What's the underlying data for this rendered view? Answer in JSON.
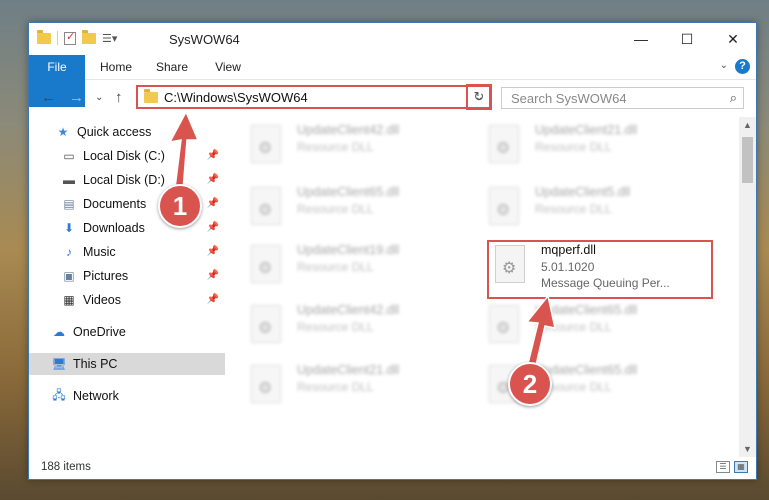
{
  "window": {
    "title": "SysWOW64",
    "controls": {
      "minimize": "—",
      "maximize": "☐",
      "close": "✕"
    }
  },
  "ribbon": {
    "tabs": [
      "File",
      "Home",
      "Share",
      "View"
    ],
    "help": "?"
  },
  "address": {
    "path": "C:\\Windows\\SysWOW64",
    "search_placeholder": "Search SysWOW64"
  },
  "nav": {
    "items": [
      {
        "label": "Quick access",
        "icon": "star-icon"
      },
      {
        "label": "Local Disk (C:)",
        "icon": "drive-icon",
        "pinned": true
      },
      {
        "label": "Local Disk (D:)",
        "icon": "drive-icon",
        "pinned": true
      },
      {
        "label": "Documents",
        "icon": "documents-icon",
        "pinned": true
      },
      {
        "label": "Downloads",
        "icon": "downloads-icon",
        "pinned": true
      },
      {
        "label": "Music",
        "icon": "music-icon",
        "pinned": true
      },
      {
        "label": "Pictures",
        "icon": "pictures-icon",
        "pinned": true
      },
      {
        "label": "Videos",
        "icon": "videos-icon",
        "pinned": true
      },
      {
        "label": "OneDrive",
        "icon": "cloud-icon"
      },
      {
        "label": "This PC",
        "icon": "computer-icon",
        "selected": true
      },
      {
        "label": "Network",
        "icon": "network-icon"
      }
    ]
  },
  "files": {
    "left": [
      {
        "name": "UpdateClient42.dll",
        "desc": "Resource DLL"
      },
      {
        "name": "UpdateClient65.dll",
        "desc": "Resource DLL"
      },
      {
        "name": "UpdateClient19.dll",
        "desc": "Resource DLL"
      },
      {
        "name": "UpdateClient42.dll",
        "desc": "Resource DLL"
      },
      {
        "name": "UpdateClient21.dll",
        "desc": "Resource DLL"
      }
    ],
    "right": [
      {
        "name": "UpdateClient21.dll",
        "desc": "Resource DLL"
      },
      {
        "name": "UpdateClient5.dll",
        "desc": "Resource DLL"
      },
      {
        "name": "UpdateClient65.dll",
        "desc": "Resource DLL"
      },
      {
        "name": "UpdateClient65.dll",
        "desc": "Resource DLL"
      }
    ],
    "highlighted": {
      "name": "mqperf.dll",
      "version": "5.01.1020",
      "desc": "Message Queuing Per..."
    }
  },
  "status": {
    "count": "188 items"
  },
  "callouts": [
    "1",
    "2"
  ],
  "colors": {
    "accent": "#1979ca",
    "highlight": "#d9534f"
  }
}
